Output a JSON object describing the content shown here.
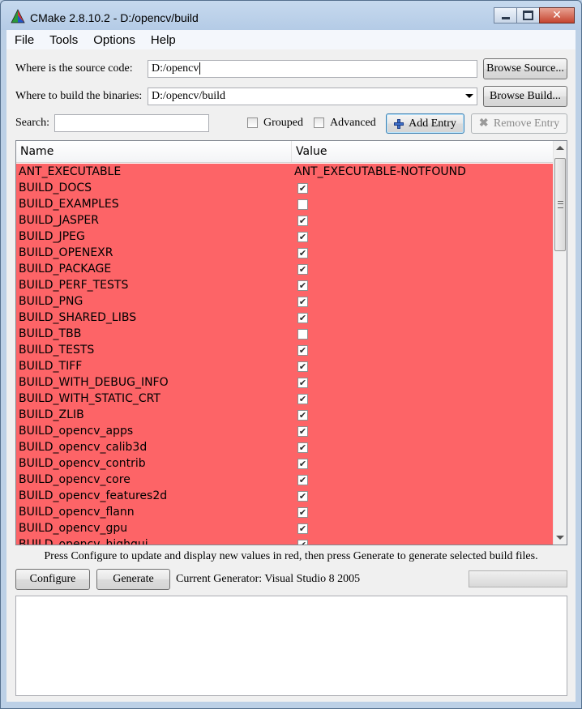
{
  "window": {
    "title": "CMake 2.8.10.2 - D:/opencv/build"
  },
  "menu": [
    "File",
    "Tools",
    "Options",
    "Help"
  ],
  "source": {
    "label": "Where is the source code:",
    "value": "D:/opencv",
    "browse_label": "Browse Source..."
  },
  "build": {
    "label": "Where to build the binaries:",
    "value": "D:/opencv/build",
    "browse_label": "Browse Build..."
  },
  "search": {
    "label": "Search:",
    "value": ""
  },
  "options": {
    "grouped_label": "Grouped",
    "advanced_label": "Advanced",
    "grouped_checked": false,
    "advanced_checked": false
  },
  "buttons": {
    "add_entry": "Add Entry",
    "remove_entry": "Remove Entry",
    "configure": "Configure",
    "generate": "Generate"
  },
  "table": {
    "headers": {
      "name": "Name",
      "value": "Value"
    },
    "rows": [
      {
        "name": "ANT_EXECUTABLE",
        "type": "text",
        "value": "ANT_EXECUTABLE-NOTFOUND"
      },
      {
        "name": "BUILD_DOCS",
        "type": "bool",
        "checked": true
      },
      {
        "name": "BUILD_EXAMPLES",
        "type": "bool",
        "checked": false
      },
      {
        "name": "BUILD_JASPER",
        "type": "bool",
        "checked": true
      },
      {
        "name": "BUILD_JPEG",
        "type": "bool",
        "checked": true
      },
      {
        "name": "BUILD_OPENEXR",
        "type": "bool",
        "checked": true
      },
      {
        "name": "BUILD_PACKAGE",
        "type": "bool",
        "checked": true
      },
      {
        "name": "BUILD_PERF_TESTS",
        "type": "bool",
        "checked": true
      },
      {
        "name": "BUILD_PNG",
        "type": "bool",
        "checked": true
      },
      {
        "name": "BUILD_SHARED_LIBS",
        "type": "bool",
        "checked": true
      },
      {
        "name": "BUILD_TBB",
        "type": "bool",
        "checked": false
      },
      {
        "name": "BUILD_TESTS",
        "type": "bool",
        "checked": true
      },
      {
        "name": "BUILD_TIFF",
        "type": "bool",
        "checked": true
      },
      {
        "name": "BUILD_WITH_DEBUG_INFO",
        "type": "bool",
        "checked": true
      },
      {
        "name": "BUILD_WITH_STATIC_CRT",
        "type": "bool",
        "checked": true
      },
      {
        "name": "BUILD_ZLIB",
        "type": "bool",
        "checked": true
      },
      {
        "name": "BUILD_opencv_apps",
        "type": "bool",
        "checked": true
      },
      {
        "name": "BUILD_opencv_calib3d",
        "type": "bool",
        "checked": true
      },
      {
        "name": "BUILD_opencv_contrib",
        "type": "bool",
        "checked": true
      },
      {
        "name": "BUILD_opencv_core",
        "type": "bool",
        "checked": true
      },
      {
        "name": "BUILD_opencv_features2d",
        "type": "bool",
        "checked": true
      },
      {
        "name": "BUILD_opencv_flann",
        "type": "bool",
        "checked": true
      },
      {
        "name": "BUILD_opencv_gpu",
        "type": "bool",
        "checked": true
      },
      {
        "name": "BUILD_opencv_highgui",
        "type": "bool",
        "checked": true
      }
    ]
  },
  "hint": "Press Configure to update and display new values in red, then press Generate to generate selected build files.",
  "generator": {
    "label": "Current Generator: Visual Studio 8 2005"
  },
  "progress": {
    "fraction": 0
  },
  "colors": {
    "new_entry_bg": "#fd6467",
    "frame": "#bcd0e6"
  },
  "icons": {
    "app": "cmake-triangle-icon",
    "add": "plus-icon",
    "remove": "x-icon",
    "check": "checkmark-icon"
  }
}
